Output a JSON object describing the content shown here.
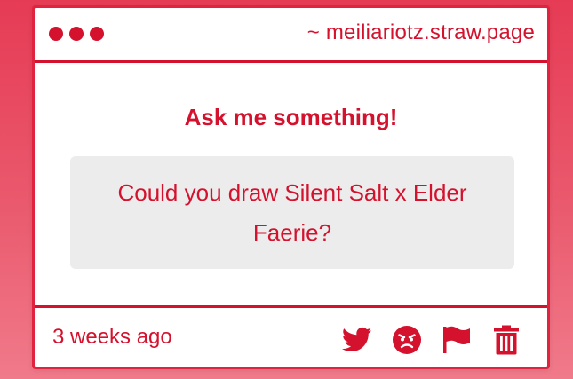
{
  "window": {
    "url": "~ meiliariotz.straw.page"
  },
  "main": {
    "heading": "Ask me something!",
    "question": "Could you draw Silent Salt x Elder Faerie?"
  },
  "footer": {
    "timestamp": "3 weeks ago",
    "actions": [
      {
        "icon": "twitter-icon"
      },
      {
        "icon": "angry-face-icon"
      },
      {
        "icon": "flag-icon"
      },
      {
        "icon": "trash-icon"
      }
    ]
  },
  "colors": {
    "accent": "#d4122e",
    "background_top": "#e63b55",
    "background_bottom": "#f07a8a",
    "question_bg": "#ececec"
  }
}
